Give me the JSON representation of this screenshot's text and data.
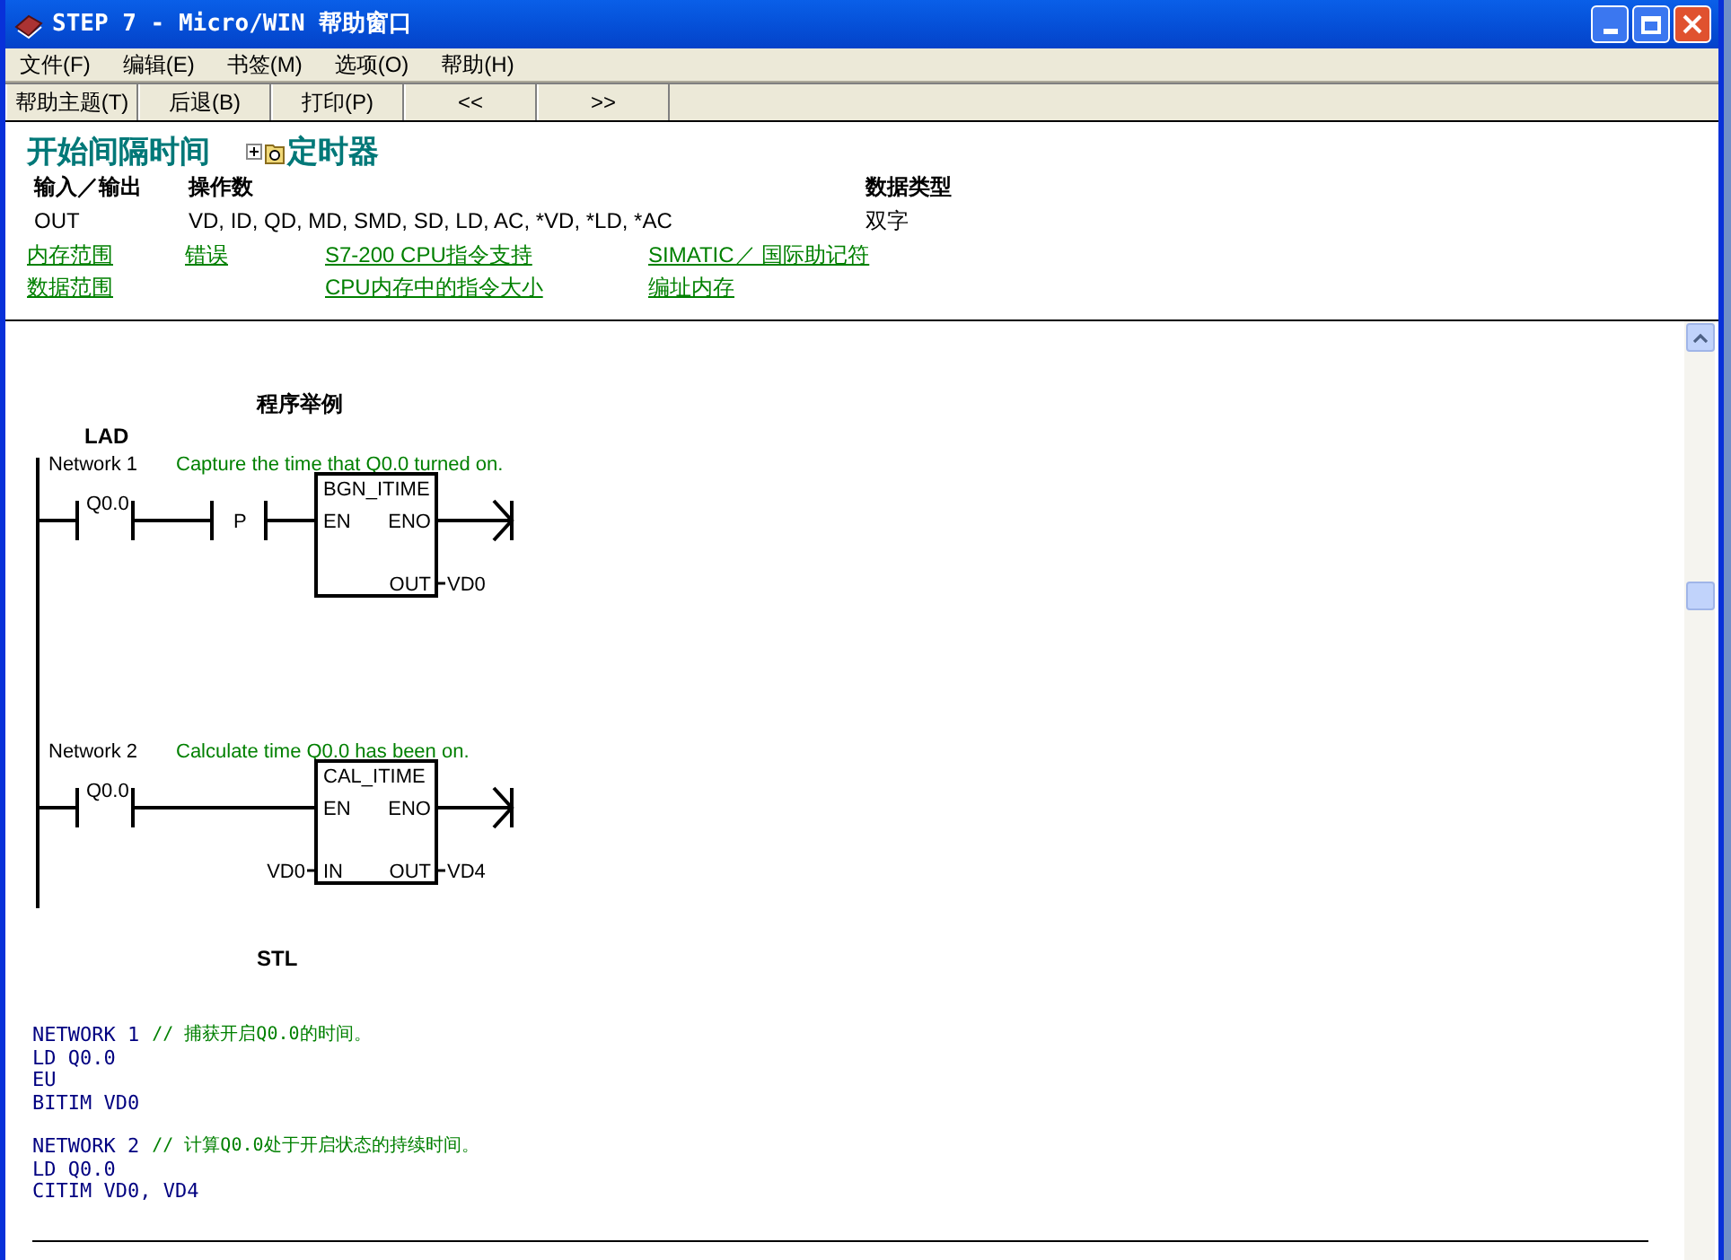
{
  "window": {
    "title": "STEP 7 - Micro/WIN 帮助窗口"
  },
  "menu": [
    "文件(F)",
    "编辑(E)",
    "书签(M)",
    "选项(O)",
    "帮助(H)"
  ],
  "toolbar": [
    "帮助主题(T)",
    "后退(B)",
    "打印(P)",
    "<<",
    ">>"
  ],
  "topic": {
    "title": "开始间隔时间",
    "breadcrumb": "定时器"
  },
  "operands": {
    "columns": [
      "输入／输出",
      "操作数",
      "数据类型"
    ],
    "rows": [
      [
        "OUT",
        "VD, ID, QD, MD, SMD, SD, LD, AC, *VD, *LD, *AC",
        "双字"
      ]
    ]
  },
  "link_columns": [
    [
      "内存范围",
      "数据范围"
    ],
    [
      "错误"
    ],
    [
      "S7-200 CPU指令支持",
      "CPU内存中的指令大小"
    ],
    [
      "SIMATIC／ 国际助记符",
      "编址内存"
    ]
  ],
  "example": {
    "heading": "程序举例",
    "lad_label": "LAD",
    "networks": [
      {
        "title": "Network 1",
        "comment": "Capture the time that Q0.0 turned on.",
        "contact": "Q0.0",
        "edge": "P",
        "box": "BGN_ITIME",
        "en": "EN",
        "eno": "ENO",
        "out": "OUT",
        "out_operand": "VD0"
      },
      {
        "title": "Network 2",
        "comment": "Calculate time Q0.0 has been on.",
        "contact": "Q0.0",
        "box": "CAL_ITIME",
        "en": "EN",
        "eno": "ENO",
        "in": "IN",
        "in_operand": "VD0",
        "out": "OUT",
        "out_operand": "VD4"
      }
    ],
    "stl_label": "STL",
    "stl": [
      {
        "network": "NETWORK 1",
        "comment": "// 捕获开启Q0.0的时间。",
        "lines": [
          "LD Q0.0",
          "EU",
          "BITIM VD0"
        ]
      },
      {
        "network": "NETWORK 2",
        "comment": "// 计算Q0.0处于开启状态的持续时间。",
        "lines": [
          "LD Q0.0",
          "CITIM VD0, VD4"
        ]
      }
    ]
  }
}
